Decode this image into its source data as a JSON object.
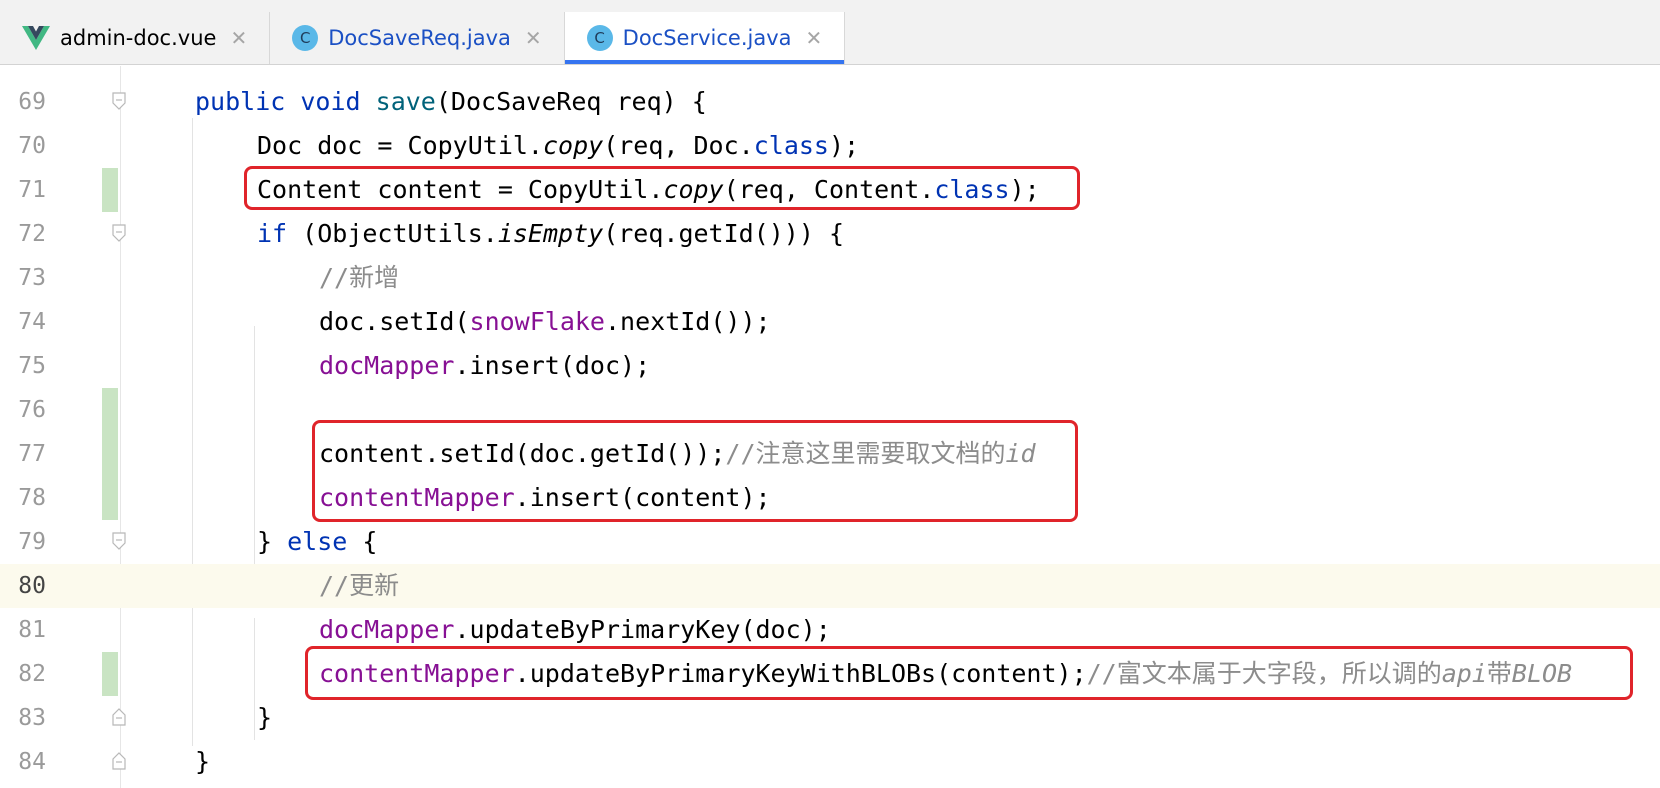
{
  "tabs": [
    {
      "label": "admin-doc.vue",
      "icon": "vue-logo-icon",
      "active": false
    },
    {
      "label": "DocSaveReq.java",
      "icon": "java-class-icon",
      "active": false
    },
    {
      "label": "DocService.java",
      "icon": "java-class-icon",
      "active": true
    }
  ],
  "tab_close_glyph": "✕",
  "java_icon_letter": "C",
  "colors": {
    "keyword": "#0033b3",
    "method": "#00627a",
    "field": "#871094",
    "comment": "#8c8c8c",
    "highlight_box": "#e0242a",
    "active_tab_underline": "#3574f0",
    "changed_line_marker": "#c9e4c3"
  },
  "lines": [
    {
      "number": "69",
      "t": [
        "public",
        " ",
        "void",
        " ",
        "save",
        "(DocSaveReq req) {"
      ]
    },
    {
      "number": "70",
      "t": [
        "Doc doc = CopyUtil.",
        "copy",
        "(req, Doc.",
        "class",
        ");"
      ]
    },
    {
      "number": "71",
      "t": [
        "Content content = CopyUtil.",
        "copy",
        "(req, Content.",
        "class",
        ");"
      ]
    },
    {
      "number": "72",
      "t": [
        "if",
        " (ObjectUtils.",
        "isEmpty",
        "(req.getId())) {"
      ]
    },
    {
      "number": "73",
      "t": [
        "//新增"
      ]
    },
    {
      "number": "74",
      "t": [
        "doc.setId(",
        "snowFlake",
        ".nextId());"
      ]
    },
    {
      "number": "75",
      "t": [
        "docMapper",
        ".insert(doc);"
      ]
    },
    {
      "number": "76",
      "t": []
    },
    {
      "number": "77",
      "t": [
        "content.setId(doc.getId());",
        "//注意这里需要取文档的",
        "id"
      ]
    },
    {
      "number": "78",
      "t": [
        "contentMapper",
        ".insert(content);"
      ]
    },
    {
      "number": "79",
      "t": [
        "} ",
        "else",
        " {"
      ]
    },
    {
      "number": "80",
      "t": [
        "//更新"
      ]
    },
    {
      "number": "81",
      "t": [
        "docMapper",
        ".updateByPrimaryKey(doc);"
      ]
    },
    {
      "number": "82",
      "t": [
        "contentMapper",
        ".updateByPrimaryKeyWithBLOBs(content);",
        "//富文本属于大字段，所以调的",
        "api",
        "带",
        "BLOB"
      ]
    },
    {
      "number": "83",
      "t": [
        "}"
      ]
    },
    {
      "number": "84",
      "t": [
        "}"
      ]
    }
  ]
}
